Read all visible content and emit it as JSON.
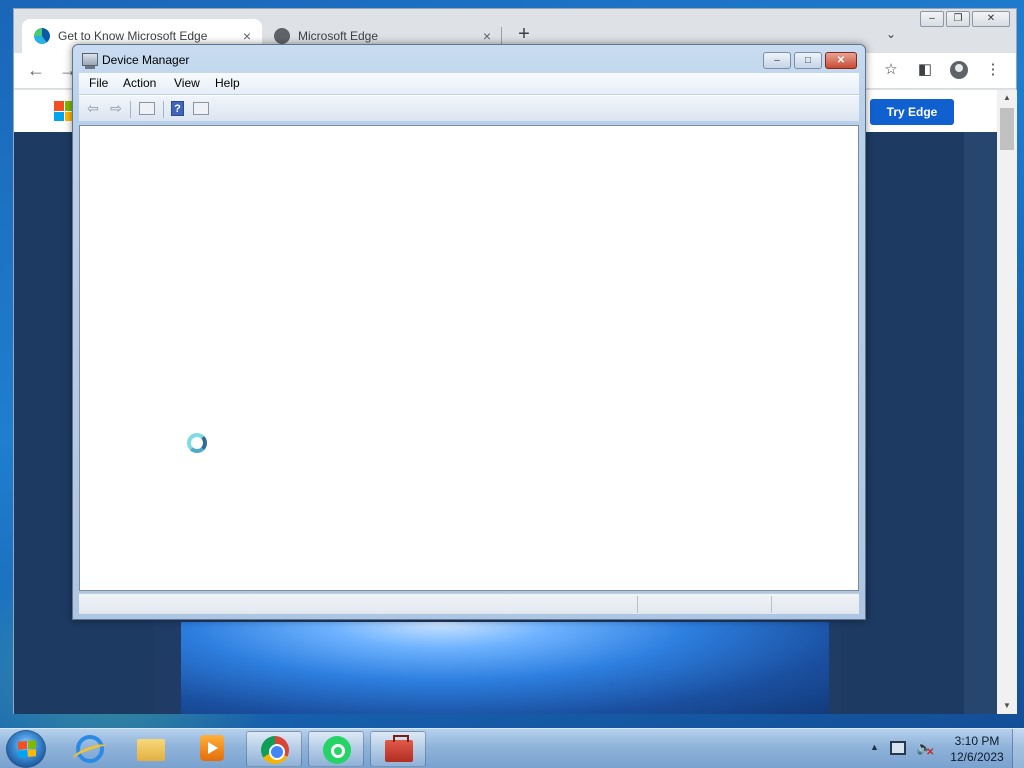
{
  "browser": {
    "tabs": [
      {
        "title": "Get to Know Microsoft Edge",
        "active": true
      },
      {
        "title": "Microsoft Edge",
        "active": false
      }
    ],
    "new_tab_symbol": "+",
    "tab_close_symbol": "×",
    "page": {
      "cta_label": "Try Edge",
      "brand_colors": [
        "#f25022",
        "#7fba00",
        "#00a4ef",
        "#ffb900"
      ],
      "cta_color": "#1160d0"
    },
    "toolbar_icons": [
      "back-arrow-icon",
      "forward-arrow-icon",
      "star-icon",
      "side-panel-icon",
      "profile-icon",
      "more-menu-icon"
    ]
  },
  "device_manager": {
    "title": "Device Manager",
    "menu": [
      "File",
      "Action",
      "View",
      "Help"
    ],
    "toolbar_icons": [
      "back-icon",
      "forward-icon",
      "show-hide-console-tree-icon",
      "help-icon",
      "properties-icon"
    ],
    "loading": true
  },
  "taskbar": {
    "pinned": [
      "start-button",
      "internet-explorer-icon",
      "windows-explorer-icon",
      "media-player-icon",
      "chrome-icon",
      "whatsapp-icon",
      "toolbox-icon"
    ],
    "clock": {
      "time": "3:10 PM",
      "date": "12/6/2023"
    }
  }
}
